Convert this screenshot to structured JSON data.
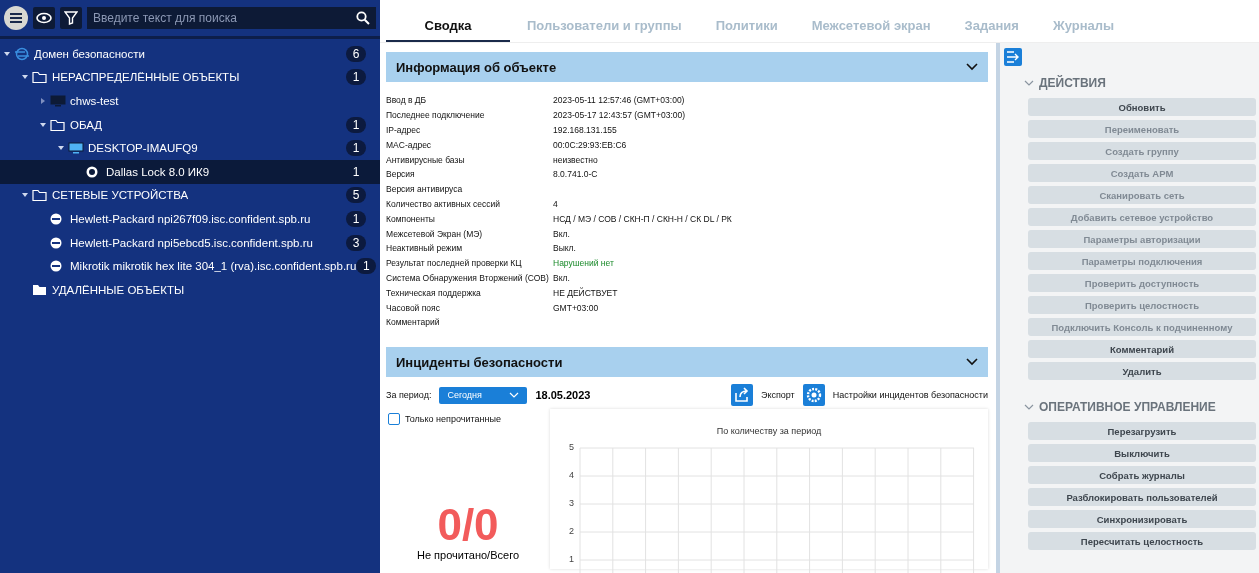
{
  "sidebar": {
    "search": {
      "placeholder": "Введите текст для поиска"
    },
    "tree": [
      {
        "label": "Домен безопасности",
        "kind": "domain",
        "count": "6",
        "expanded": true,
        "selected": false,
        "children": [
          {
            "label": "НЕРАСПРЕДЕЛЁННЫЕ ОБЪЕКТЫ",
            "kind": "folder",
            "count": "1",
            "expanded": true,
            "selected": false,
            "children": [
              {
                "label": "chws-test",
                "kind": "offline",
                "expanded": false,
                "selected": false
              },
              {
                "label": "ОБАД",
                "kind": "folder",
                "count": "1",
                "expanded": true,
                "selected": false,
                "children": [
                  {
                    "label": "DESKTOP-IMAUFQ9",
                    "kind": "computer",
                    "count": "1",
                    "expanded": true,
                    "selected": false,
                    "children": [
                      {
                        "label": "Dallas Lock 8.0 ИК9",
                        "kind": "product",
                        "count": "1",
                        "selected": true
                      }
                    ]
                  }
                ]
              }
            ]
          },
          {
            "label": "СЕТЕВЫЕ УСТРОЙСТВА",
            "kind": "folder",
            "count": "5",
            "expanded": true,
            "selected": false,
            "children": [
              {
                "label": "Hewlett-Packard npi267f09.isc.confident.spb.ru",
                "kind": "device",
                "count": "1",
                "selected": false
              },
              {
                "label": "Hewlett-Packard npi5ebcd5.isc.confident.spb.ru",
                "kind": "device",
                "count": "3",
                "selected": false
              },
              {
                "label": "Mikrotik mikrotik hex lite 304_1 (rva).isc.confident.spb.ru",
                "kind": "device",
                "count": "1",
                "selected": false
              }
            ]
          },
          {
            "label": "УДАЛЁННЫЕ ОБЪЕКТЫ",
            "kind": "trash",
            "selected": false
          }
        ]
      }
    ]
  },
  "tabs": [
    {
      "label": "Сводка",
      "selected": true
    },
    {
      "label": "Пользователи и группы",
      "selected": false
    },
    {
      "label": "Политики",
      "selected": false
    },
    {
      "label": "Межсетевой экран",
      "selected": false
    },
    {
      "label": "Задания",
      "selected": false
    },
    {
      "label": "Журналы",
      "selected": false
    }
  ],
  "object_info": {
    "title": "Информация об объекте",
    "rows": [
      {
        "label": "Ввод в ДБ",
        "value": "2023-05-11 12:57:46 (GMT+03:00)"
      },
      {
        "label": "Последнее подключение",
        "value": "2023-05-17 12:43:57 (GMT+03:00)"
      },
      {
        "label": "IP-адрес",
        "value": "192.168.131.155"
      },
      {
        "label": "MAC-адрес",
        "value": "00:0C:29:93:EB:C6"
      },
      {
        "label": "Антивирусные базы",
        "value": "неизвестно"
      },
      {
        "label": "Версия",
        "value": "8.0.741.0-C"
      },
      {
        "label": "Версия антивируса"
      },
      {
        "label": "Количество активных сессий",
        "value": "4"
      },
      {
        "label": "Компоненты",
        "value": "НСД / МЭ / СОВ / СКН-П / СКН-Н / СК DL / РК"
      },
      {
        "label": "Межсетевой Экран (МЭ)",
        "value": "Вкл."
      },
      {
        "label": "Неактивный режим",
        "value": "Выкл."
      },
      {
        "label": "Результат последней проверки КЦ",
        "value": "Нарушений нет",
        "kind": "ok"
      },
      {
        "label": "Система Обнаружения Вторжений (СОВ)",
        "value": "Вкл."
      },
      {
        "label": "Техническая поддержка",
        "value": "НЕ ДЕЙСТВУЕТ"
      },
      {
        "label": "Часовой пояс",
        "value": "GMT+03:00"
      },
      {
        "label": "Комментарий"
      }
    ]
  },
  "incidents": {
    "title": "Инциденты безопасности",
    "period_label": "За период:",
    "period": "Сегодня",
    "date": "18.05.2023",
    "export": "Экспорт",
    "settings": "Настройки инцидентов безопасности",
    "unread_only": {
      "label": "Только непрочитанные",
      "checked": false
    },
    "counter": "0/0",
    "counter_caption": "Не прочитано/Всего",
    "chart": {
      "title": "По количеству за период",
      "y_axis_labels": [
        "5",
        "4",
        "3",
        "2",
        "1"
      ]
    }
  },
  "actions": [
    {
      "title": "ДЕЙСТВИЯ",
      "expanded": true,
      "buttons": [
        {
          "label": "Обновить",
          "disabled": false
        },
        {
          "label": "Переименовать",
          "disabled": true
        },
        {
          "label": "Создать группу",
          "disabled": true
        },
        {
          "label": "Создать АРМ",
          "disabled": true
        },
        {
          "label": "Сканировать сеть",
          "disabled": true
        },
        {
          "label": "Добавить сетевое устройство",
          "disabled": true
        },
        {
          "label": "Параметры авторизации",
          "disabled": true
        },
        {
          "label": "Параметры подключения",
          "disabled": true
        },
        {
          "label": "Проверить доступность",
          "disabled": true
        },
        {
          "label": "Проверить целостность",
          "disabled": true
        },
        {
          "label": "Подключить Консоль к подчиненному",
          "disabled": true
        },
        {
          "label": "Комментарий",
          "disabled": false
        },
        {
          "label": "Удалить",
          "disabled": false
        }
      ]
    },
    {
      "title": "ОПЕРАТИВНОЕ УПРАВЛЕНИЕ",
      "expanded": true,
      "buttons": [
        {
          "label": "Перезагрузить",
          "disabled": false
        },
        {
          "label": "Выключить",
          "disabled": false
        },
        {
          "label": "Собрать журналы",
          "disabled": false
        },
        {
          "label": "Разблокировать пользователей",
          "disabled": false
        },
        {
          "label": "Синхронизировать",
          "disabled": false
        },
        {
          "label": "Пересчитать целостность",
          "disabled": false
        }
      ]
    }
  ]
}
